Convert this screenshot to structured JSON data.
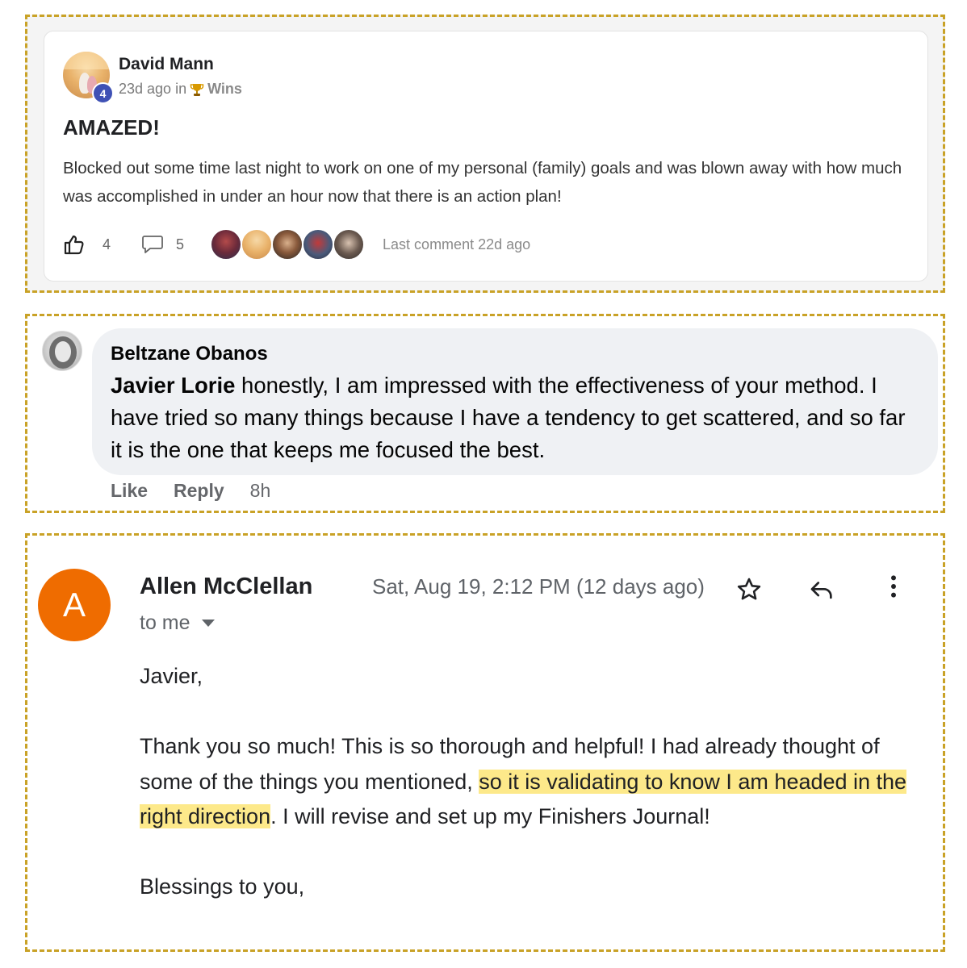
{
  "post": {
    "author": "David Mann",
    "level": "4",
    "time_ago": "23d ago in",
    "category": "Wins",
    "title": "AMAZED!",
    "body": "Blocked out some time last night to work on one of my personal (family) goals and was blown away with how much was accomplished in under an hour now that there is an action plan!",
    "likes": "4",
    "comments": "5",
    "last_comment": "Last comment 22d ago",
    "icons": {
      "like": "thumbs-up-icon",
      "comment": "speech-bubble-icon",
      "category": "trophy-icon"
    },
    "commenter_count": 5
  },
  "comment": {
    "author": "Beltzane Obanos",
    "mention": "Javier Lorie",
    "text": " honestly, I am impressed with the effectiveness of your method. I have tried so many things because I have a tendency to get scattered, and so far it is the one that keeps me focused the best.",
    "actions": {
      "like": "Like",
      "reply": "Reply",
      "time": "8h"
    }
  },
  "email": {
    "avatar_letter": "A",
    "sender": "Allen McClellan",
    "date": "Sat, Aug 19, 2:12 PM (12 days ago)",
    "to": "to me",
    "greeting": "Javier,",
    "para_before": "Thank you so much!  This is so thorough and helpful!  I had already thought of some of the things you mentioned, ",
    "para_highlight": "so it is validating to know I am headed in the right direction",
    "para_after": ".  I will revise and set up my Finishers Journal!",
    "closing": "Blessings to you,",
    "icons": {
      "star": "star-icon",
      "reply": "reply-icon",
      "more": "more-vertical-icon"
    }
  },
  "colors": {
    "frame_border": "#c9a227",
    "level_badge": "#3f51b5",
    "mail_avatar": "#ef6c00",
    "highlight": "#fde98a",
    "bubble": "#eff1f4"
  }
}
